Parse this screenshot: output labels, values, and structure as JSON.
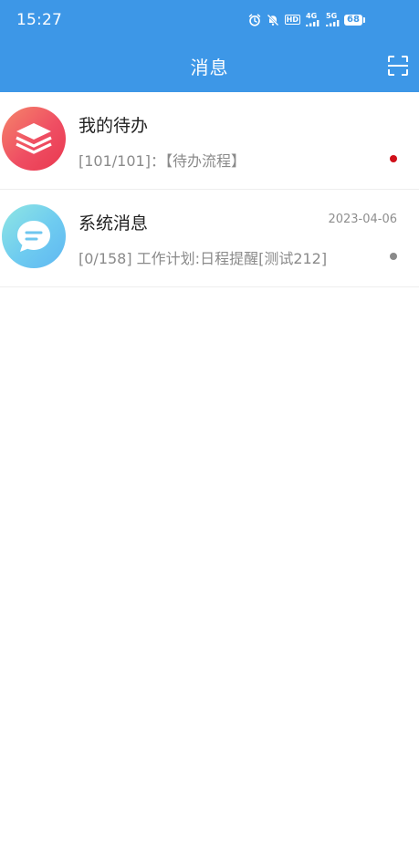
{
  "status_bar": {
    "time": "15:27",
    "hd_label": "HD",
    "network_4g": "4G",
    "network_5g": "5G",
    "battery": "68",
    "icons": [
      "alarm-icon",
      "mute-bell-icon",
      "hd-icon",
      "signal-icon",
      "signal-icon",
      "wifi-icon",
      "battery-icon"
    ]
  },
  "nav": {
    "title": "消息",
    "scan_icon": "scan-icon"
  },
  "messages": [
    {
      "title": "我的待办",
      "date": "",
      "preview": "[101/101]：【待办流程】",
      "icon": "stack-layers-icon",
      "dot_color": "#d0101a"
    },
    {
      "title": "系统消息",
      "date": "2023-04-06",
      "preview": "[0/158]  工作计划:日程提醒[测试212]",
      "icon": "chat-bubble-icon",
      "dot_color": "#8a8a8a"
    }
  ],
  "colors": {
    "accent": "#3d97e7",
    "unread_dot": "#d0101a",
    "read_dot": "#8a8a8a"
  }
}
